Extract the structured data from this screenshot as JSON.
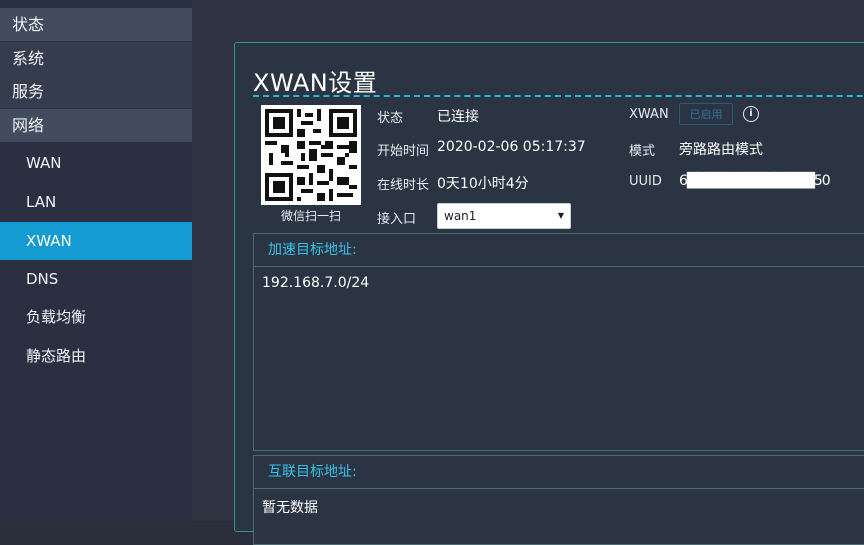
{
  "sidebar": {
    "groups": [
      {
        "label": "状态"
      },
      {
        "label": "系统"
      },
      {
        "label": "服务"
      },
      {
        "label": "网络"
      }
    ],
    "sub_items": [
      {
        "label": "WAN"
      },
      {
        "label": "LAN"
      },
      {
        "label": "XWAN"
      },
      {
        "label": "DNS"
      },
      {
        "label": "负载均衡"
      },
      {
        "label": "静态路由"
      }
    ]
  },
  "panel": {
    "title": "XWAN设置",
    "qr_caption": "微信扫一扫",
    "status_label": "状态",
    "status_value": "已连接",
    "start_label": "开始时间",
    "start_value": "2020-02-06 05:17:37",
    "online_label": "在线时长",
    "online_value": "0天10小时4分",
    "port_label": "接入口",
    "port_value": "wan1",
    "xwan_label": "XWAN",
    "enabled_button": "已启用",
    "info_icon": "i",
    "mode_label": "模式",
    "mode_value": "旁路路由模式",
    "uuid_label": "UUID",
    "uuid_value": "6█████████████50"
  },
  "accelerate": {
    "title": "加速目标地址:",
    "value": "192.168.7.0/24"
  },
  "interconnect": {
    "title": "互联目标地址:",
    "value": "暂无数据"
  },
  "colors": {
    "active": "#139bd2",
    "accent": "#36c2e8",
    "panel_border": "#3f8f8c"
  }
}
